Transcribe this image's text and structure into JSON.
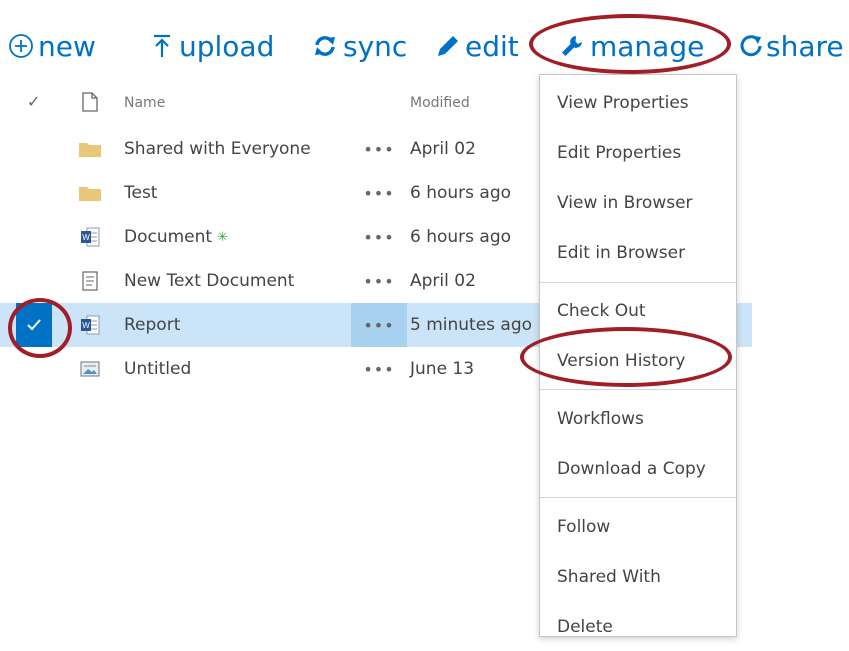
{
  "toolbar": {
    "new_label": "new",
    "upload_label": "upload",
    "sync_label": "sync",
    "edit_label": "edit",
    "manage_label": "manage",
    "share_label": "share"
  },
  "header": {
    "name_label": "Name",
    "modified_label": "Modified"
  },
  "files": [
    {
      "name": "Shared with Everyone",
      "modified": "April 02",
      "icon": "folder-icon",
      "dots": "•••"
    },
    {
      "name": "Test",
      "modified": "6 hours ago",
      "icon": "folder-icon",
      "dots": "•••"
    },
    {
      "name": "Document",
      "modified": "6 hours ago",
      "icon": "word-document-icon",
      "dots": "•••",
      "new_badge": "✳"
    },
    {
      "name": "New Text Document",
      "modified": "April 02",
      "icon": "text-document-icon",
      "dots": "•••"
    },
    {
      "name": "Report",
      "modified": "5 minutes ago",
      "icon": "word-document-icon",
      "dots": "•••",
      "selected": true
    },
    {
      "name": "Untitled",
      "modified": "June 13",
      "icon": "image-icon",
      "dots": "•••"
    }
  ],
  "manage_menu": {
    "items": [
      "View Properties",
      "Edit Properties",
      "View in Browser",
      "Edit in Browser",
      "Check Out",
      "Version History",
      "Workflows",
      "Download a Copy",
      "Follow",
      "Shared With",
      "Delete"
    ]
  },
  "colors": {
    "accent": "#0072c6",
    "selected_row": "#cce4f7",
    "annotation": "#a01e25",
    "folder": "#e8c878"
  }
}
